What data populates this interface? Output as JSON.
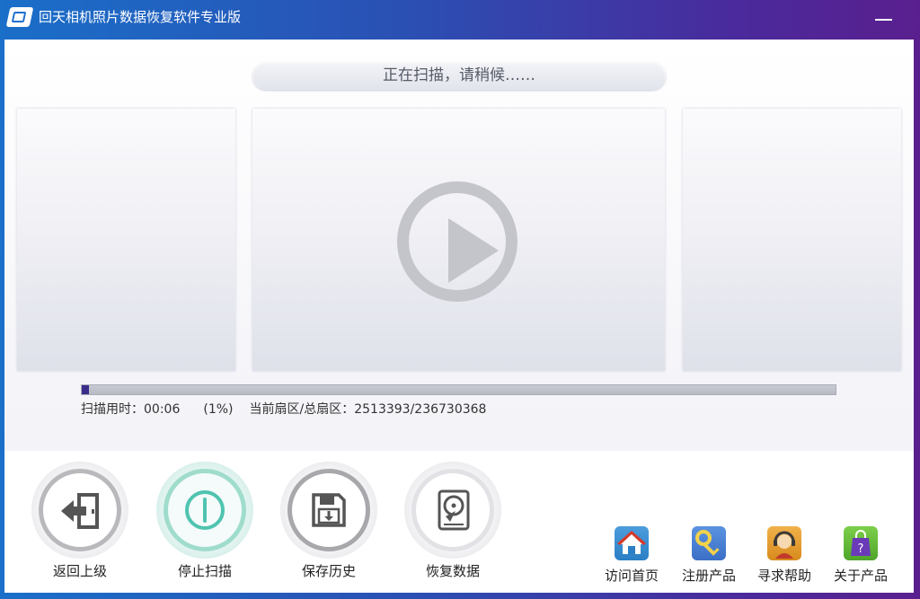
{
  "titlebar": {
    "title": "回天相机照片数据恢复软件专业版",
    "logo_icon": "app-logo-icon",
    "minimize_icon": "minimize-icon"
  },
  "status": {
    "message": "正在扫描，请稍候……"
  },
  "preview": {
    "main_icon": "play-icon"
  },
  "progress": {
    "percent": 1,
    "elapsed_label": "扫描用时：00:06",
    "percent_label": "(1%)",
    "sector_label": "当前扇区/总扇区：2513393/236730368"
  },
  "actions": [
    {
      "label": "返回上级",
      "icon": "back-exit-icon"
    },
    {
      "label": "停止扫描",
      "icon": "power-icon"
    },
    {
      "label": "保存历史",
      "icon": "floppy-save-icon"
    },
    {
      "label": "恢复数据",
      "icon": "hard-disk-icon"
    }
  ],
  "links": [
    {
      "label": "访问首页",
      "icon": "home-icon",
      "color": "#2b7fc4"
    },
    {
      "label": "注册产品",
      "icon": "key-icon",
      "color": "#3b6fc6"
    },
    {
      "label": "寻求帮助",
      "icon": "support-agent-icon",
      "color": "#d88a1c"
    },
    {
      "label": "关于产品",
      "icon": "shopping-bag-question-icon",
      "color": "#4fa52a"
    }
  ],
  "colors": {
    "titlebar_start": "#1a6fc9",
    "titlebar_end": "#5a1f8e",
    "progress_fill": "#3a2d8a",
    "stop_accent": "#4fc4b0"
  }
}
